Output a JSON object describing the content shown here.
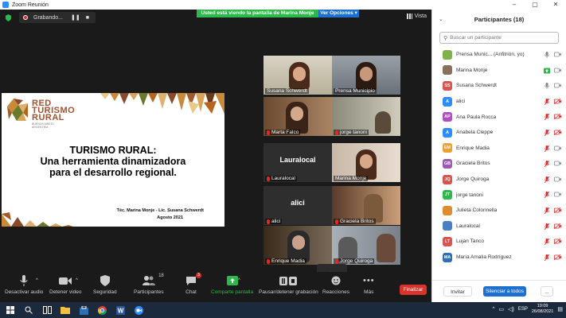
{
  "window": {
    "title": "Zoom Reunión"
  },
  "topbar": {
    "recording_label": "Grabando...",
    "banner_message": "Usted está viendo la pantalla de Marina Monje",
    "banner_options": "Ver Opciones",
    "view_label": "Vista"
  },
  "slide": {
    "logo_line1": "RED",
    "logo_line2": "TURISMO",
    "logo_line3": "RURAL",
    "logo_sub1": "BUENOS AIRES /",
    "logo_sub2": "ARGENTINA",
    "title_line1": "TURISMO RURAL:",
    "title_line2": "Una herramienta dinamizadora",
    "title_line3": "para el desarrollo regional.",
    "authors": "Téc. Marina Monje  - Lic. Susana Schwerdt",
    "date": "Agosto 2021"
  },
  "tiles": [
    {
      "name": "Susana Schwerdt"
    },
    {
      "name": "Prensa Municipio"
    },
    {
      "name": "Marta Falco"
    },
    {
      "name": "jorge tanoni"
    },
    {
      "name": "Lauralocal"
    },
    {
      "name": "Marina Monje"
    },
    {
      "name": "alici"
    },
    {
      "name": "Graciela Britos"
    },
    {
      "name": "Enrique Madia"
    },
    {
      "name": "Jorge Quiroga"
    }
  ],
  "tile_bignames": {
    "laura": "Lauralocal",
    "alici": "alici"
  },
  "toolbar": {
    "mute": "Desactivar audio",
    "video": "Detener video",
    "security": "Seguridad",
    "participants": "Participantes",
    "participants_count": "18",
    "chat": "Chat",
    "chat_badge": "3",
    "share": "Comparte pantalla",
    "record": "Pausar/detener grabación",
    "reactions": "Reacciones",
    "more": "Más",
    "end": "Finalizar"
  },
  "panel": {
    "title": "Participantes (18)",
    "search_placeholder": "Buscar un participante",
    "invite": "Invitar",
    "mute_all": "Silenciar a todos",
    "more": "...",
    "participants": [
      {
        "initials": "",
        "name": "Prensa Munic... (Anfitrión, yo)",
        "color": "#7fb24a",
        "mic": "on",
        "cam": "on"
      },
      {
        "initials": "",
        "name": "Marina Monje",
        "color": "#8a6f5a",
        "mic": "share",
        "cam": "on"
      },
      {
        "initials": "SS",
        "name": "Susana Schwerdt",
        "color": "#d9534f",
        "mic": "on",
        "cam": "on"
      },
      {
        "initials": "A",
        "name": "alici",
        "color": "#2d8cff",
        "mic": "off",
        "cam": "off"
      },
      {
        "initials": "AP",
        "name": "Ana Paula Rocca",
        "color": "#b04fc4",
        "mic": "off",
        "cam": "off"
      },
      {
        "initials": "A",
        "name": "Anabela Cleppe",
        "color": "#2d8cff",
        "mic": "off",
        "cam": "off"
      },
      {
        "initials": "EM",
        "name": "Enrique Madia",
        "color": "#f0a030",
        "mic": "off",
        "cam": "on"
      },
      {
        "initials": "GB",
        "name": "Graciela Britos",
        "color": "#9b59b6",
        "mic": "off",
        "cam": "on"
      },
      {
        "initials": "JQ",
        "name": "Jorge Quiroga",
        "color": "#d9534f",
        "mic": "off",
        "cam": "on"
      },
      {
        "initials": "JT",
        "name": "jorge tanoni",
        "color": "#2db84b",
        "mic": "off",
        "cam": "on"
      },
      {
        "initials": "",
        "name": "Julieta Colonnella",
        "color": "#e08a30",
        "mic": "off",
        "cam": "off"
      },
      {
        "initials": "",
        "name": "Lauralocal",
        "color": "#4a7fc4",
        "mic": "off",
        "cam": "off"
      },
      {
        "initials": "LT",
        "name": "Lujan Tanco",
        "color": "#d9534f",
        "mic": "off",
        "cam": "off"
      },
      {
        "initials": "MA",
        "name": "María Amalia Rodríguez",
        "color": "#2d6fb0",
        "mic": "off",
        "cam": "off"
      }
    ]
  },
  "taskbar": {
    "lang": "ESP",
    "time": "19:09",
    "date": "26/08/2021"
  },
  "colors": {
    "accent_blue": "#2d8cff",
    "banner_green": "#2db84b",
    "end_red": "#d9342b",
    "active_speaker": "#c7d92f"
  }
}
